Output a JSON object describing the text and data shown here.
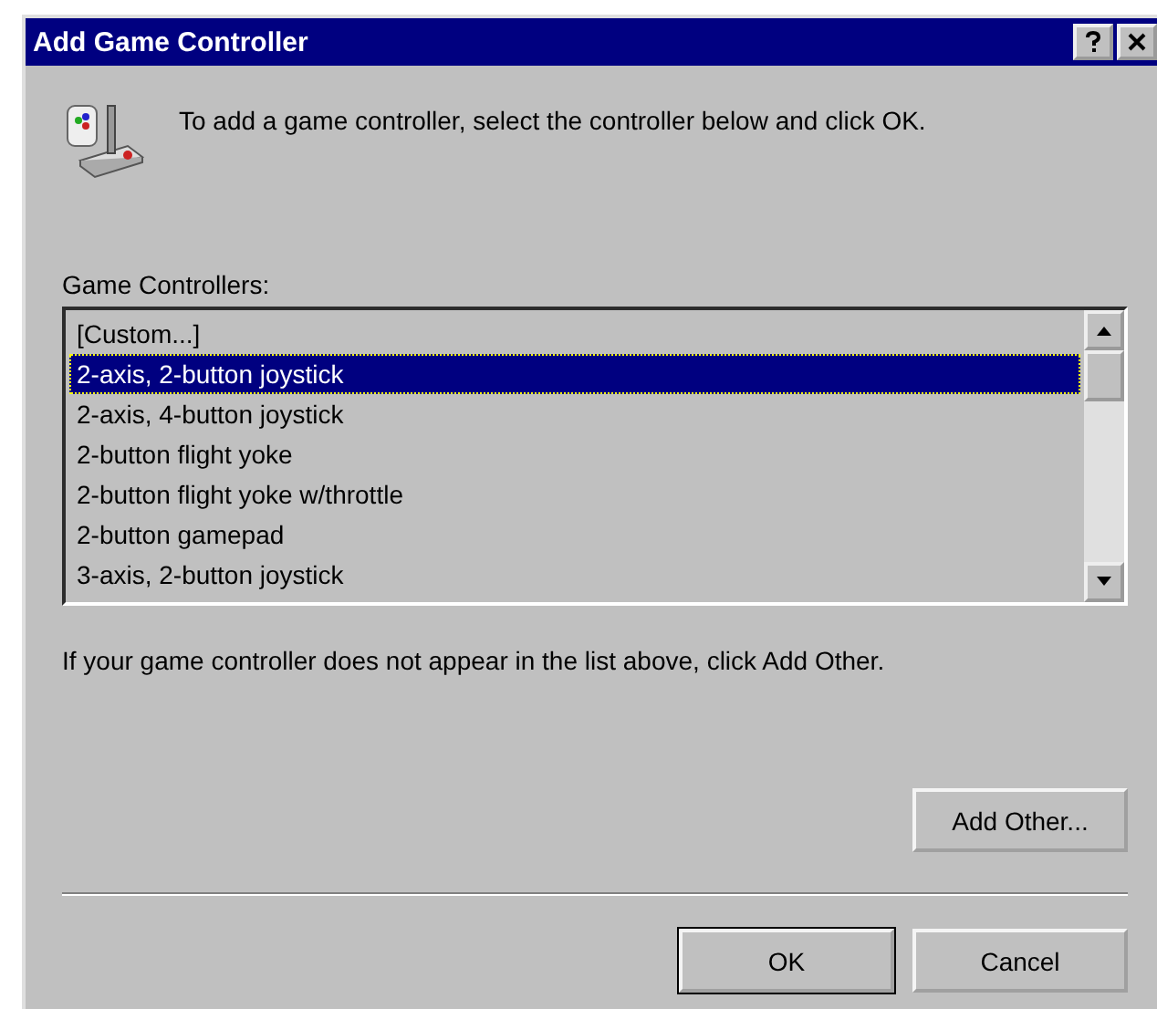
{
  "window": {
    "title": "Add Game Controller"
  },
  "instruction": "To add a game controller, select the controller below and click OK.",
  "list": {
    "label": "Game Controllers:",
    "items": [
      {
        "text": "[Custom...]",
        "selected": false
      },
      {
        "text": "2-axis, 2-button joystick",
        "selected": true
      },
      {
        "text": "2-axis, 4-button joystick",
        "selected": false
      },
      {
        "text": "2-button flight yoke",
        "selected": false
      },
      {
        "text": "2-button flight yoke w/throttle",
        "selected": false
      },
      {
        "text": "2-button gamepad",
        "selected": false
      },
      {
        "text": "3-axis, 2-button joystick",
        "selected": false
      }
    ]
  },
  "note": "If your game controller does not appear in the list above, click Add Other.",
  "buttons": [
    {
      "label": "Add Other...",
      "kind": "side"
    },
    {
      "label": "OK",
      "kind": "default"
    },
    {
      "label": "Cancel",
      "kind": "normal"
    }
  ]
}
